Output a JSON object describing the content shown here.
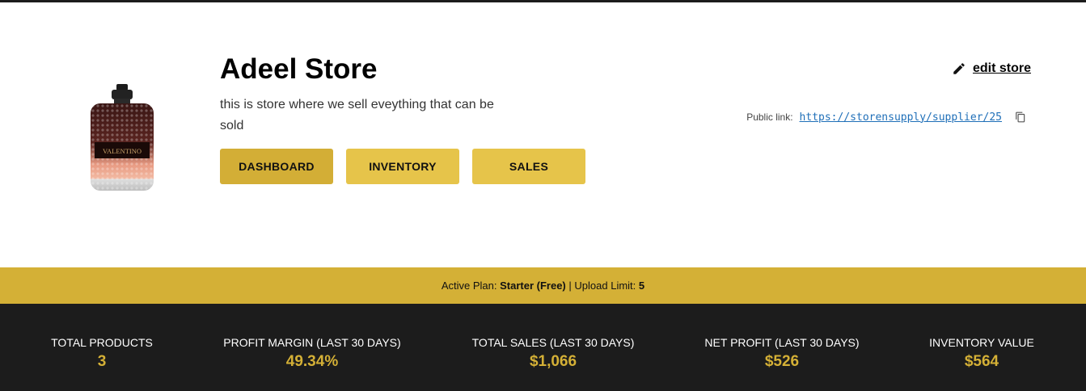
{
  "store": {
    "name": "Adeel Store",
    "description": "this is store where we sell eveything that can be sold",
    "image_label": "VALENTINO"
  },
  "nav": {
    "dashboard": "DASHBOARD",
    "inventory": "INVENTORY",
    "sales": "SALES",
    "active": "dashboard"
  },
  "edit": {
    "icon": "pencil-icon",
    "label": "edit store"
  },
  "public_link": {
    "label": "Public link:",
    "url": "https://storensupply/supplier/25",
    "copy_icon": "copy-icon"
  },
  "plan": {
    "prefix": "Active Plan:",
    "name": "Starter (Free)",
    "separator": "|",
    "limit_label": "Upload Limit:",
    "limit_value": "5"
  },
  "stats": [
    {
      "label": "TOTAL PRODUCTS",
      "value": "3"
    },
    {
      "label": "PROFIT MARGIN (LAST 30 DAYS)",
      "value": "49.34%"
    },
    {
      "label": "TOTAL SALES (LAST 30 DAYS)",
      "value": "$1,066"
    },
    {
      "label": "NET PROFIT (LAST 30 DAYS)",
      "value": "$526"
    },
    {
      "label": "INVENTORY VALUE",
      "value": "$564"
    }
  ],
  "colors": {
    "accent": "#d4b036",
    "button": "#e6c44a",
    "button_active": "#d3ae36",
    "dark": "#1c1c1c",
    "link": "#1f6fb8"
  }
}
